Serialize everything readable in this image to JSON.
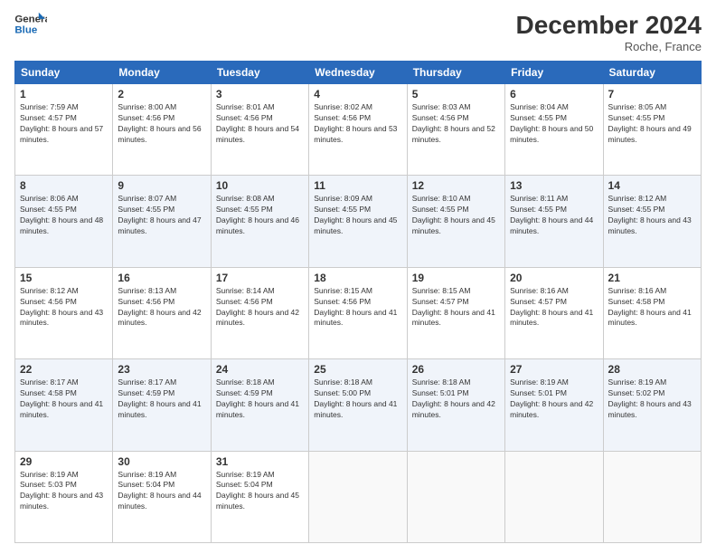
{
  "header": {
    "logo_line1": "General",
    "logo_line2": "Blue",
    "month_title": "December 2024",
    "location": "Roche, France"
  },
  "weekdays": [
    "Sunday",
    "Monday",
    "Tuesday",
    "Wednesday",
    "Thursday",
    "Friday",
    "Saturday"
  ],
  "weeks": [
    [
      {
        "day": "1",
        "sunrise": "Sunrise: 7:59 AM",
        "sunset": "Sunset: 4:57 PM",
        "daylight": "Daylight: 8 hours and 57 minutes."
      },
      {
        "day": "2",
        "sunrise": "Sunrise: 8:00 AM",
        "sunset": "Sunset: 4:56 PM",
        "daylight": "Daylight: 8 hours and 56 minutes."
      },
      {
        "day": "3",
        "sunrise": "Sunrise: 8:01 AM",
        "sunset": "Sunset: 4:56 PM",
        "daylight": "Daylight: 8 hours and 54 minutes."
      },
      {
        "day": "4",
        "sunrise": "Sunrise: 8:02 AM",
        "sunset": "Sunset: 4:56 PM",
        "daylight": "Daylight: 8 hours and 53 minutes."
      },
      {
        "day": "5",
        "sunrise": "Sunrise: 8:03 AM",
        "sunset": "Sunset: 4:56 PM",
        "daylight": "Daylight: 8 hours and 52 minutes."
      },
      {
        "day": "6",
        "sunrise": "Sunrise: 8:04 AM",
        "sunset": "Sunset: 4:55 PM",
        "daylight": "Daylight: 8 hours and 50 minutes."
      },
      {
        "day": "7",
        "sunrise": "Sunrise: 8:05 AM",
        "sunset": "Sunset: 4:55 PM",
        "daylight": "Daylight: 8 hours and 49 minutes."
      }
    ],
    [
      {
        "day": "8",
        "sunrise": "Sunrise: 8:06 AM",
        "sunset": "Sunset: 4:55 PM",
        "daylight": "Daylight: 8 hours and 48 minutes."
      },
      {
        "day": "9",
        "sunrise": "Sunrise: 8:07 AM",
        "sunset": "Sunset: 4:55 PM",
        "daylight": "Daylight: 8 hours and 47 minutes."
      },
      {
        "day": "10",
        "sunrise": "Sunrise: 8:08 AM",
        "sunset": "Sunset: 4:55 PM",
        "daylight": "Daylight: 8 hours and 46 minutes."
      },
      {
        "day": "11",
        "sunrise": "Sunrise: 8:09 AM",
        "sunset": "Sunset: 4:55 PM",
        "daylight": "Daylight: 8 hours and 45 minutes."
      },
      {
        "day": "12",
        "sunrise": "Sunrise: 8:10 AM",
        "sunset": "Sunset: 4:55 PM",
        "daylight": "Daylight: 8 hours and 45 minutes."
      },
      {
        "day": "13",
        "sunrise": "Sunrise: 8:11 AM",
        "sunset": "Sunset: 4:55 PM",
        "daylight": "Daylight: 8 hours and 44 minutes."
      },
      {
        "day": "14",
        "sunrise": "Sunrise: 8:12 AM",
        "sunset": "Sunset: 4:55 PM",
        "daylight": "Daylight: 8 hours and 43 minutes."
      }
    ],
    [
      {
        "day": "15",
        "sunrise": "Sunrise: 8:12 AM",
        "sunset": "Sunset: 4:56 PM",
        "daylight": "Daylight: 8 hours and 43 minutes."
      },
      {
        "day": "16",
        "sunrise": "Sunrise: 8:13 AM",
        "sunset": "Sunset: 4:56 PM",
        "daylight": "Daylight: 8 hours and 42 minutes."
      },
      {
        "day": "17",
        "sunrise": "Sunrise: 8:14 AM",
        "sunset": "Sunset: 4:56 PM",
        "daylight": "Daylight: 8 hours and 42 minutes."
      },
      {
        "day": "18",
        "sunrise": "Sunrise: 8:15 AM",
        "sunset": "Sunset: 4:56 PM",
        "daylight": "Daylight: 8 hours and 41 minutes."
      },
      {
        "day": "19",
        "sunrise": "Sunrise: 8:15 AM",
        "sunset": "Sunset: 4:57 PM",
        "daylight": "Daylight: 8 hours and 41 minutes."
      },
      {
        "day": "20",
        "sunrise": "Sunrise: 8:16 AM",
        "sunset": "Sunset: 4:57 PM",
        "daylight": "Daylight: 8 hours and 41 minutes."
      },
      {
        "day": "21",
        "sunrise": "Sunrise: 8:16 AM",
        "sunset": "Sunset: 4:58 PM",
        "daylight": "Daylight: 8 hours and 41 minutes."
      }
    ],
    [
      {
        "day": "22",
        "sunrise": "Sunrise: 8:17 AM",
        "sunset": "Sunset: 4:58 PM",
        "daylight": "Daylight: 8 hours and 41 minutes."
      },
      {
        "day": "23",
        "sunrise": "Sunrise: 8:17 AM",
        "sunset": "Sunset: 4:59 PM",
        "daylight": "Daylight: 8 hours and 41 minutes."
      },
      {
        "day": "24",
        "sunrise": "Sunrise: 8:18 AM",
        "sunset": "Sunset: 4:59 PM",
        "daylight": "Daylight: 8 hours and 41 minutes."
      },
      {
        "day": "25",
        "sunrise": "Sunrise: 8:18 AM",
        "sunset": "Sunset: 5:00 PM",
        "daylight": "Daylight: 8 hours and 41 minutes."
      },
      {
        "day": "26",
        "sunrise": "Sunrise: 8:18 AM",
        "sunset": "Sunset: 5:01 PM",
        "daylight": "Daylight: 8 hours and 42 minutes."
      },
      {
        "day": "27",
        "sunrise": "Sunrise: 8:19 AM",
        "sunset": "Sunset: 5:01 PM",
        "daylight": "Daylight: 8 hours and 42 minutes."
      },
      {
        "day": "28",
        "sunrise": "Sunrise: 8:19 AM",
        "sunset": "Sunset: 5:02 PM",
        "daylight": "Daylight: 8 hours and 43 minutes."
      }
    ],
    [
      {
        "day": "29",
        "sunrise": "Sunrise: 8:19 AM",
        "sunset": "Sunset: 5:03 PM",
        "daylight": "Daylight: 8 hours and 43 minutes."
      },
      {
        "day": "30",
        "sunrise": "Sunrise: 8:19 AM",
        "sunset": "Sunset: 5:04 PM",
        "daylight": "Daylight: 8 hours and 44 minutes."
      },
      {
        "day": "31",
        "sunrise": "Sunrise: 8:19 AM",
        "sunset": "Sunset: 5:04 PM",
        "daylight": "Daylight: 8 hours and 45 minutes."
      },
      null,
      null,
      null,
      null
    ]
  ]
}
